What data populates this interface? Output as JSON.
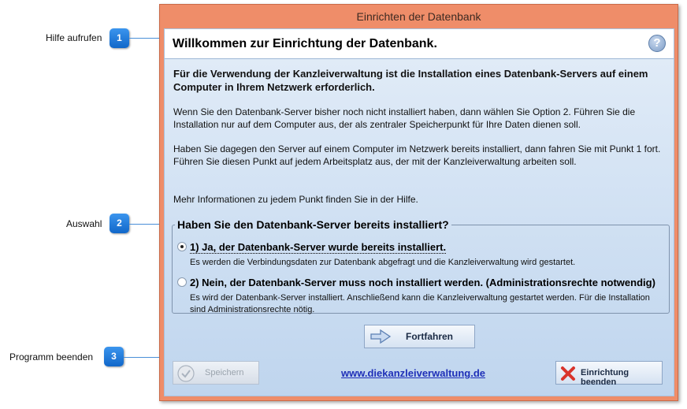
{
  "callouts": [
    {
      "number": "1",
      "label": "Hilfe aufrufen"
    },
    {
      "number": "2",
      "label": "Auswahl"
    },
    {
      "number": "3",
      "label": "Programm beenden"
    }
  ],
  "window": {
    "title": "Einrichten der Datenbank",
    "header_title": "Willkommen zur Einrichtung der Datenbank.",
    "help_icon": "?",
    "intro": "Für die Verwendung der Kanzleiverwaltung ist die Installation eines Datenbank-Servers auf einem Computer in Ihrem Netzwerk erforderlich.",
    "paragraph1": "Wenn Sie den Datenbank-Server bisher noch nicht installiert haben, dann wählen Sie Option 2. Führen Sie die Installation nur auf dem Computer aus, der als zentraler Speicherpunkt für Ihre Daten dienen soll.",
    "paragraph2": "Haben Sie dagegen den Server auf einem Computer im Netzwerk bereits installiert, dann fahren Sie mit Punkt 1 fort. Führen Sie diesen Punkt auf jedem Arbeitsplatz aus, der mit der Kanzleiverwaltung arbeiten soll.",
    "paragraph3": "Mehr Informationen zu jedem Punkt finden Sie in der Hilfe.",
    "group_title": "Haben Sie den Datenbank-Server bereits installiert?",
    "options": [
      {
        "label": "1) Ja, der Datenbank-Server wurde bereits installiert.",
        "description": "Es werden die Verbindungsdaten zur Datenbank abgefragt und die Kanzleiverwaltung wird gestartet.",
        "selected": true
      },
      {
        "label": "2) Nein, der Datenbank-Server muss noch installiert werden. (Administrationsrechte notwendig)",
        "description": "Es wird der Datenbank-Server installiert. Anschließend kann die Kanzleiverwaltung gestartet werden. Für die Installation sind Administrationsrechte nötig.",
        "selected": false
      }
    ],
    "continue_button": "Fortfahren",
    "save_button": "Speichern",
    "website_link": "www.diekanzleiverwaltung.de",
    "exit_button": "Einrichtung beenden"
  },
  "icons": {
    "help": "question-circle-icon",
    "continue": "arrow-right-icon",
    "save": "check-circle-icon",
    "exit": "red-x-icon"
  },
  "colors": {
    "window_frame": "#ef8d69",
    "client_bg": "#d3e2f3",
    "callout_badge": "#1f7ad9",
    "link": "#1e2fb8",
    "exit_icon": "#d9342b"
  }
}
